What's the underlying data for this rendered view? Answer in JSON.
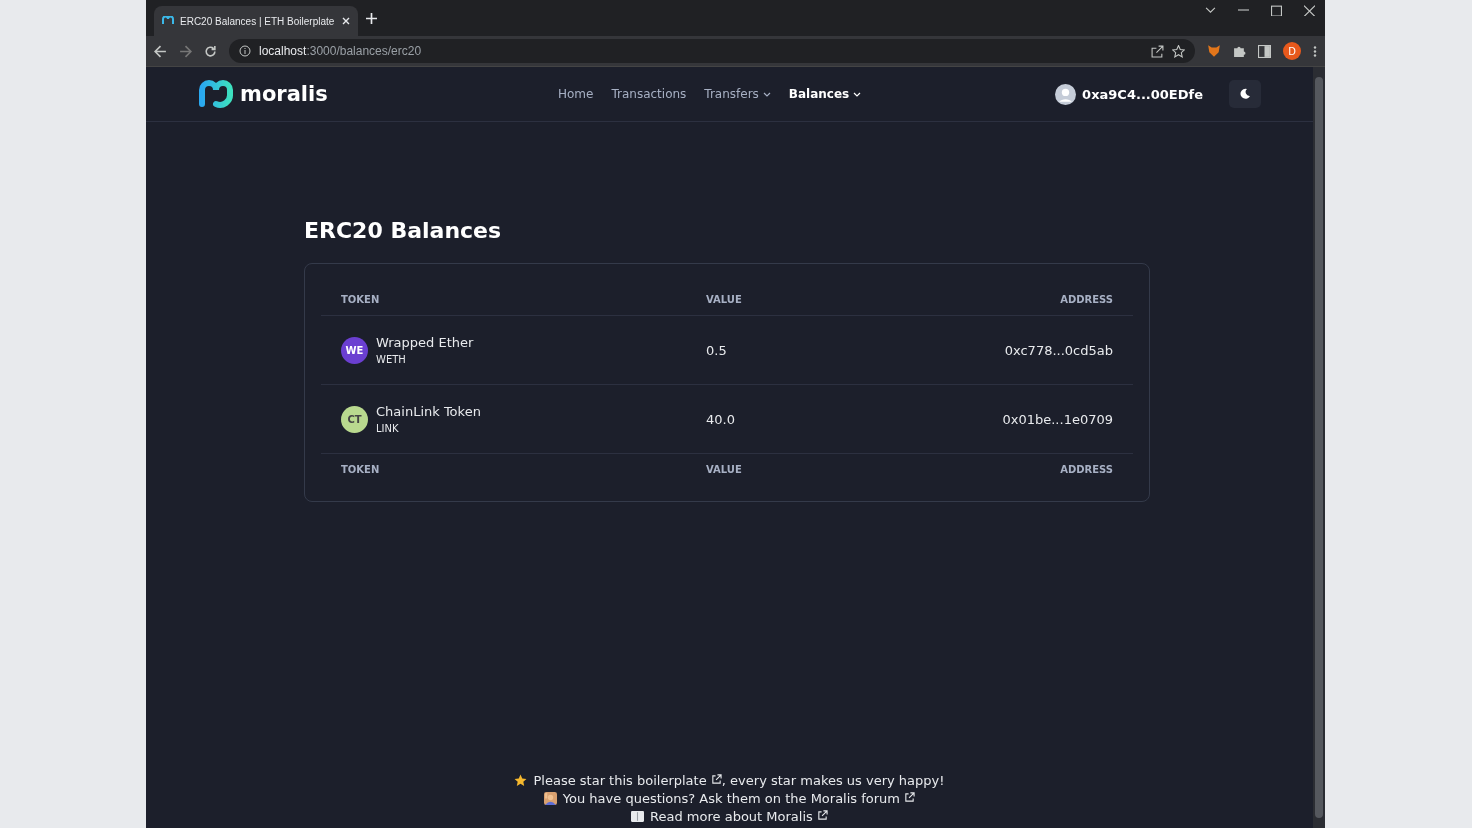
{
  "browser": {
    "tab_title": "ERC20 Balances | ETH Boilerplate",
    "url_host": "localhost",
    "url_path": ":3000/balances/erc20",
    "profile_initial": "D"
  },
  "header": {
    "logo_text": "moralis",
    "nav": [
      {
        "label": "Home",
        "selected": false,
        "dropdown": false
      },
      {
        "label": "Transactions",
        "selected": false,
        "dropdown": false
      },
      {
        "label": "Transfers",
        "selected": false,
        "dropdown": true
      },
      {
        "label": "Balances",
        "selected": true,
        "dropdown": true
      }
    ],
    "account": "0xa9C4...00EDfe"
  },
  "title": "ERC20 Balances",
  "table": {
    "columns": [
      "TOKEN",
      "VALUE",
      "ADDRESS"
    ],
    "rows": [
      {
        "initials": "WE",
        "color": "#6b3fd1",
        "name": "Wrapped Ether",
        "symbol": "WETH",
        "value": "0.5",
        "address": "0xc778...0cd5ab"
      },
      {
        "initials": "CT",
        "color": "#b9d98f",
        "name": "ChainLink Token",
        "symbol": "LINK",
        "value": "40.0",
        "address": "0x01be...1e0709"
      }
    ],
    "footer_columns": [
      "TOKEN",
      "VALUE",
      "ADDRESS"
    ]
  },
  "footer": [
    {
      "kind": "star",
      "before": "Please star this ",
      "link": "boilerplate",
      "after": ", every star makes us very happy!"
    },
    {
      "kind": "person",
      "before": "You have questions? Ask them on the ",
      "link": "Moralis forum"
    },
    {
      "kind": "book",
      "link": "Read more about Moralis"
    }
  ]
}
